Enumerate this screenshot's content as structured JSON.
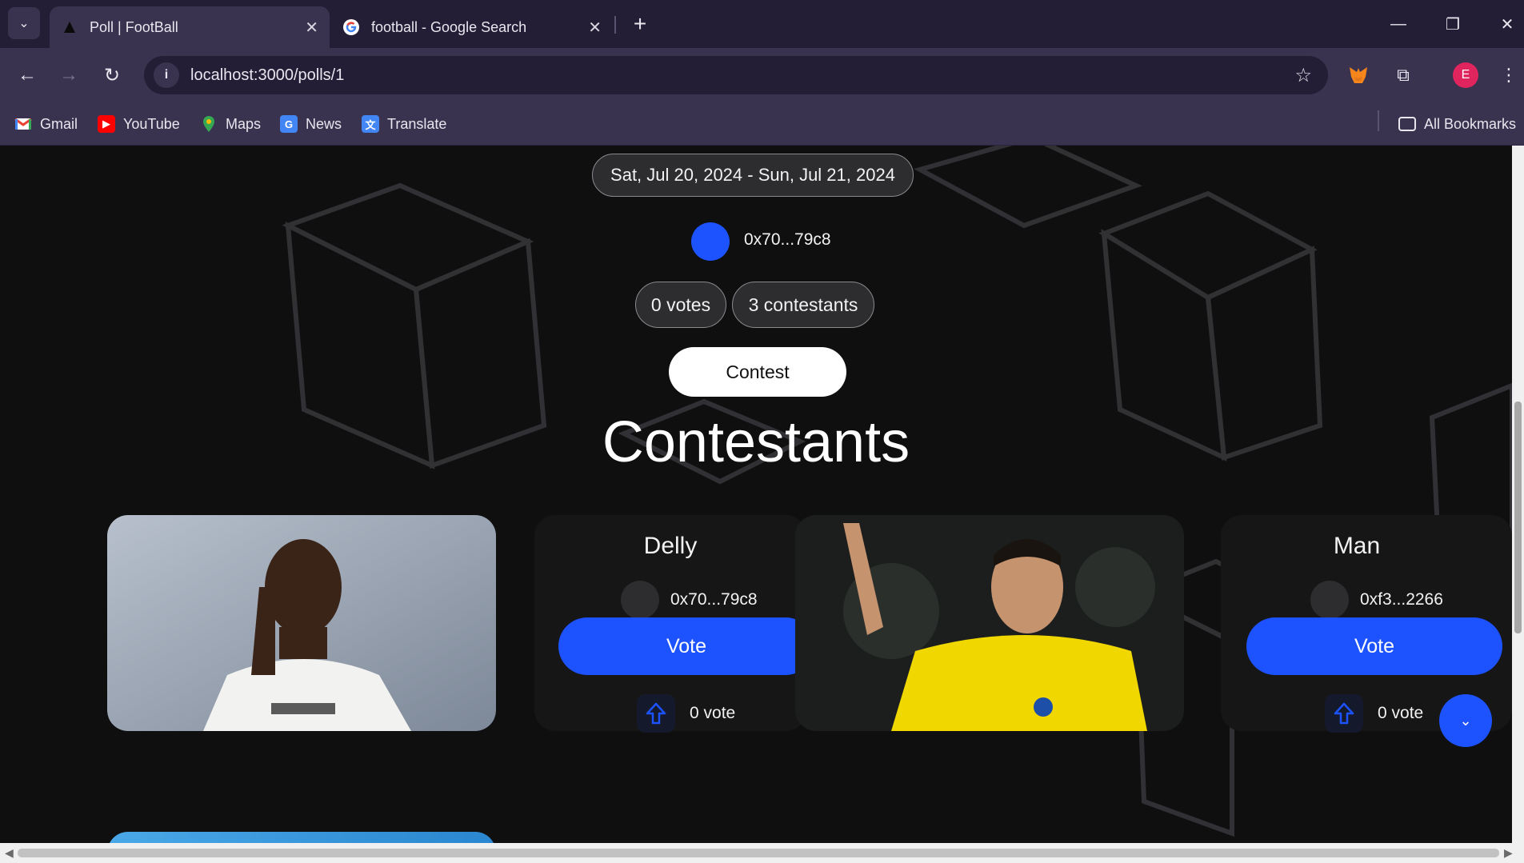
{
  "browser": {
    "tabs": [
      {
        "title": "Poll | FootBall",
        "active": true
      },
      {
        "title": "football - Google Search",
        "active": false
      }
    ],
    "url": "localhost:3000/polls/1",
    "profile_initial": "E",
    "bookmarks": [
      {
        "label": "Gmail"
      },
      {
        "label": "YouTube"
      },
      {
        "label": "Maps"
      },
      {
        "label": "News"
      },
      {
        "label": "Translate"
      }
    ],
    "all_bookmarks": "All Bookmarks"
  },
  "poll": {
    "date_range": "Sat, Jul 20, 2024 - Sun, Jul 21, 2024",
    "owner_address": "0x70...79c8",
    "votes": "0 votes",
    "contestants_count": "3 contestants",
    "contest_label": "Contest",
    "heading": "Contestants"
  },
  "contestants": [
    {
      "name": "Delly",
      "address": "0x70...79c8",
      "vote_label": "Vote",
      "votes": "0 vote"
    },
    {
      "name": "Man",
      "address": "0xf3...2266",
      "vote_label": "Vote",
      "votes": "0 vote"
    }
  ],
  "colors": {
    "accent": "#1c53ff",
    "chrome_dark": "#231d35",
    "chrome": "#3a3350",
    "page_bg": "#0f0f10",
    "card_bg": "#161617"
  }
}
